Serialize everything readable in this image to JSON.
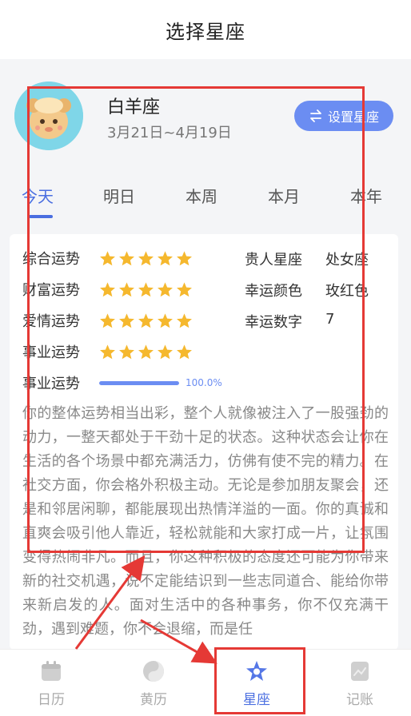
{
  "header": {
    "title": "选择星座"
  },
  "profile": {
    "sign_name": "白羊座",
    "date_range": "3月21日~4月19日",
    "set_button_label": "设置星座"
  },
  "tabs": [
    {
      "label": "今天",
      "active": true
    },
    {
      "label": "明日",
      "active": false
    },
    {
      "label": "本周",
      "active": false
    },
    {
      "label": "本月",
      "active": false
    },
    {
      "label": "本年",
      "active": false
    }
  ],
  "fortune": {
    "rows": [
      {
        "label": "综合运势",
        "stars": 5
      },
      {
        "label": "财富运势",
        "stars": 5
      },
      {
        "label": "爱情运势",
        "stars": 5
      },
      {
        "label": "事业运势",
        "stars": 5
      }
    ],
    "progress": {
      "label": "事业运势",
      "value": 1.0,
      "text": "100.0%"
    },
    "info": [
      {
        "label": "贵人星座",
        "value": "处女座"
      },
      {
        "label": "幸运颜色",
        "value": "玫红色"
      },
      {
        "label": "幸运数字",
        "value": "7"
      }
    ],
    "description": "你的整体运势相当出彩，整个人就像被注入了一股强劲的动力，一整天都处于干劲十足的状态。这种状态会让你在生活的各个场景中都充满活力，仿佛有使不完的精力。在社交方面，你会格外积极主动。无论是参加朋友聚会，还是和邻居闲聊，都能展现出热情洋溢的一面。你的真诚和直爽会吸引他人靠近，轻松就能和大家打成一片，让氛围变得热闹非凡。而且，你这种积极的态度还可能为你带来新的社交机遇，说不定能结识到一些志同道合、能给你带来新启发的人。面对生活中的各种事务，你不仅充满干劲，遇到难题，你不会退缩，而是任"
  },
  "bottom_nav": [
    {
      "label": "日历",
      "icon": "calendar-icon",
      "active": false
    },
    {
      "label": "黄历",
      "icon": "yin-yang-icon",
      "active": false
    },
    {
      "label": "星座",
      "icon": "star-icon",
      "active": true
    },
    {
      "label": "记账",
      "icon": "ledger-icon",
      "active": false
    }
  ],
  "colors": {
    "accent": "#4a6ee0",
    "button": "#6b8df2",
    "star": "#f5b82e",
    "annotation": "#e53935"
  }
}
